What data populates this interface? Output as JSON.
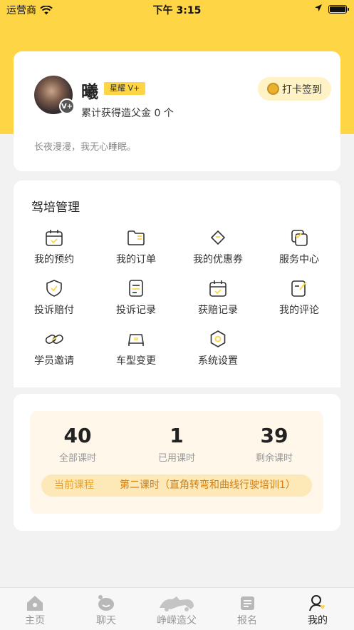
{
  "status_bar": {
    "carrier": "运营商",
    "time": "下午 3:15"
  },
  "profile": {
    "avatar_badge": "V+",
    "username": "曦",
    "vip_tag": "星耀 V+",
    "fund_text": "累计获得造父金 0 个",
    "checkin_label": "打卡签到",
    "motto": "长夜漫漫，我无心睡眠。"
  },
  "management": {
    "title": "驾培管理",
    "items": [
      {
        "label": "我的预约",
        "icon": "calendar-icon"
      },
      {
        "label": "我的订单",
        "icon": "folder-icon"
      },
      {
        "label": "我的优惠券",
        "icon": "ticket-icon"
      },
      {
        "label": "服务中心",
        "icon": "service-icon"
      },
      {
        "label": "投诉赔付",
        "icon": "shield-icon"
      },
      {
        "label": "投诉记录",
        "icon": "document-icon"
      },
      {
        "label": "获赔记录",
        "icon": "calendar-check-icon"
      },
      {
        "label": "我的评论",
        "icon": "edit-icon"
      },
      {
        "label": "学员邀请",
        "icon": "link-icon"
      },
      {
        "label": "车型变更",
        "icon": "car-icon"
      },
      {
        "label": "系统设置",
        "icon": "settings-icon"
      }
    ]
  },
  "stats": {
    "total": {
      "value": "40",
      "label": "全部课时"
    },
    "used": {
      "value": "1",
      "label": "已用课时"
    },
    "remaining": {
      "value": "39",
      "label": "剩余课时"
    },
    "current_course_key": "当前课程",
    "current_course_value": "第二课时（直角转弯和曲线行驶培训1）"
  },
  "tabbar": {
    "items": [
      {
        "label": "主页",
        "icon": "home-icon"
      },
      {
        "label": "聊天",
        "icon": "chat-icon"
      },
      {
        "label": "峥嵘造父",
        "icon": "horse-logo-icon"
      },
      {
        "label": "报名",
        "icon": "signup-icon"
      },
      {
        "label": "我的",
        "icon": "profile-icon"
      }
    ],
    "active_index": 4
  },
  "colors": {
    "brand_yellow": "#fdd545",
    "course_key": "#e9a126",
    "course_value": "#cf7f14"
  }
}
